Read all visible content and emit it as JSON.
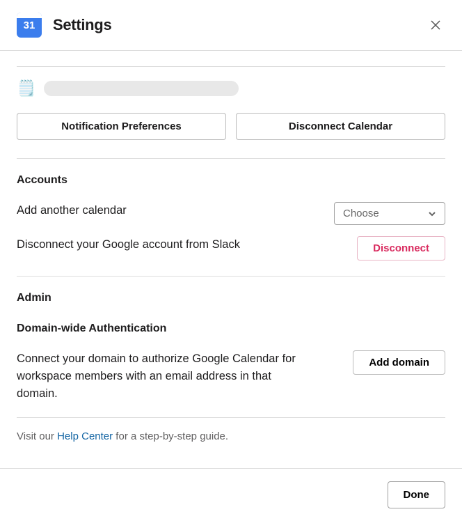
{
  "header": {
    "icon_label": "31",
    "title": "Settings"
  },
  "actions": {
    "notification_prefs": "Notification Preferences",
    "disconnect_calendar": "Disconnect Calendar"
  },
  "accounts": {
    "title": "Accounts",
    "add_calendar_label": "Add another calendar",
    "choose_placeholder": "Choose",
    "disconnect_label": "Disconnect your Google account from Slack",
    "disconnect_button": "Disconnect"
  },
  "admin": {
    "title": "Admin",
    "subtitle": "Domain-wide Authentication",
    "description": "Connect your domain to authorize Google Calendar for workspace members with an email address in that domain.",
    "add_domain_button": "Add domain"
  },
  "help": {
    "prefix": "Visit our ",
    "link": "Help Center",
    "suffix": " for a step-by-step guide."
  },
  "footer": {
    "done": "Done"
  }
}
